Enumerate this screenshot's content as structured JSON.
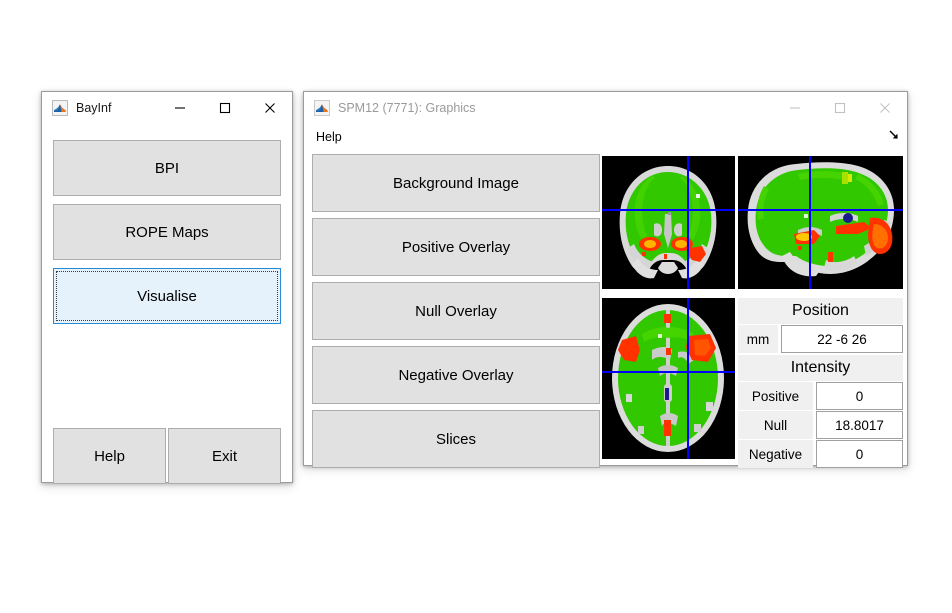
{
  "bayinf_window": {
    "title": "BayInf",
    "icon": "matlab-icon",
    "controls": {
      "minimize": "minimize-icon",
      "maximize": "maximize-icon",
      "close": "close-icon"
    },
    "buttons": [
      {
        "id": "bpi",
        "label": "BPI",
        "focused": false
      },
      {
        "id": "rope",
        "label": "ROPE Maps",
        "focused": false
      },
      {
        "id": "visualise",
        "label": "Visualise",
        "focused": true
      },
      {
        "id": "help",
        "label": "Help",
        "focused": false
      },
      {
        "id": "exit",
        "label": "Exit",
        "focused": false
      }
    ],
    "focus_color": "#e5f1fb",
    "focus_border": "#2a8ad4"
  },
  "spm_window": {
    "title": "SPM12 (7771): Graphics",
    "icon": "matlab-icon",
    "active": false,
    "menu": {
      "items": [
        "Help"
      ],
      "resize_icon": "resize-arrow-icon"
    },
    "controls": {
      "minimize": "minimize-icon",
      "maximize": "maximize-icon",
      "close": "close-icon"
    },
    "buttons": [
      {
        "id": "background-image",
        "label": "Background Image"
      },
      {
        "id": "positive-overlay",
        "label": "Positive Overlay"
      },
      {
        "id": "null-overlay",
        "label": "Null Overlay"
      },
      {
        "id": "negative-overlay",
        "label": "Negative Overlay"
      },
      {
        "id": "slices",
        "label": "Slices"
      }
    ],
    "brain_views": [
      {
        "id": "coronal",
        "name": "coronal-brain-slice"
      },
      {
        "id": "sagittal",
        "name": "sagittal-brain-slice"
      },
      {
        "id": "axial",
        "name": "axial-brain-slice"
      }
    ],
    "readout": {
      "position_heading": "Position",
      "mm_label": "mm",
      "mm_value": "22 -6 26",
      "intensity_heading": "Intensity",
      "rows": [
        {
          "label": "Positive",
          "value": "0"
        },
        {
          "label": "Null",
          "value": "18.8017"
        },
        {
          "label": "Negative",
          "value": "0"
        }
      ]
    },
    "overlay_colors": {
      "null_overlay": "#32c800",
      "positive_overlay": "#ff3200",
      "positive_hot": "#ffc800",
      "crosshair": "#0000ff",
      "background_brain": "#d8d8d8"
    }
  }
}
